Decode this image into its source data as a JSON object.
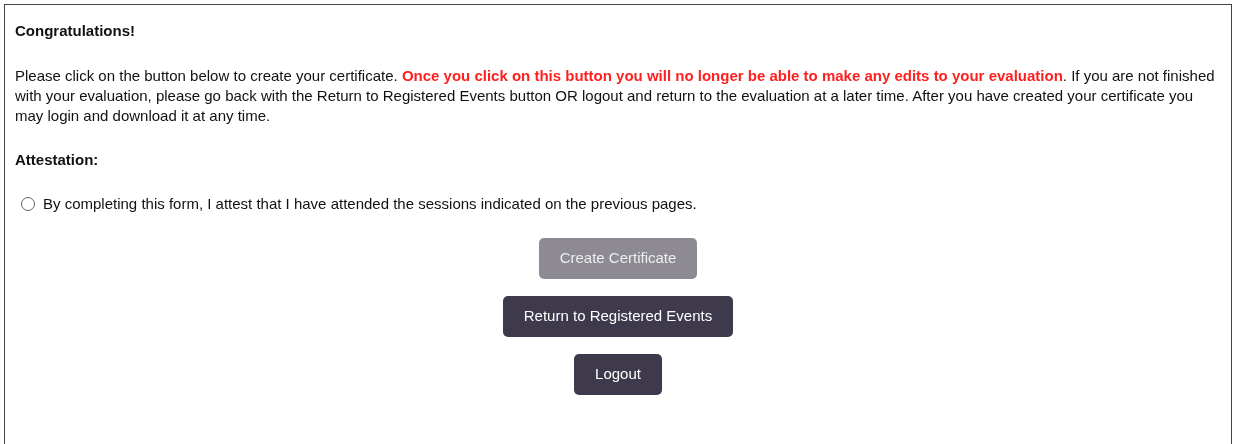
{
  "heading": "Congratulations!",
  "message": "Please click on the button below to create your certificate. **Once you click on this button you will no longer be able to make any edits to your evaluation**. If you are not finished with your evaluation, please go back with the Return to Registered Events button OR logout and return to the evaluation at a later time. After you have created your certificate you may login and download it at any time.",
  "attestation_label": "Attestation:",
  "attestation_option": {
    "label": "By completing this form, I attest that I have attended the sessions indicated on the previous pages.",
    "selected": false
  },
  "buttons": [
    {
      "label": "Create Certificate",
      "disabled": true
    },
    {
      "label": "Return to Registered Events",
      "disabled": false
    },
    {
      "label": "Logout",
      "disabled": false
    }
  ]
}
